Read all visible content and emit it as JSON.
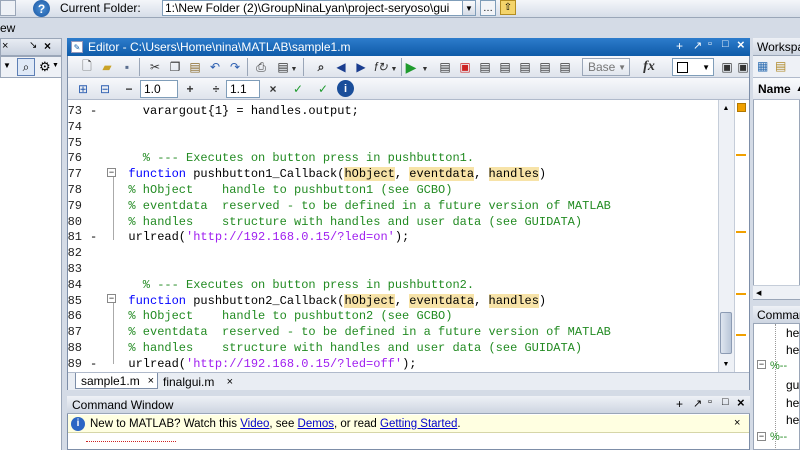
{
  "top": {
    "folder_label": "Current Folder:",
    "folder_path": "1:\\New Folder (2)\\GroupNinaLyan\\project-seryoso\\gui"
  },
  "left": {
    "view_label": "ew"
  },
  "editor": {
    "title": "Editor - C:\\Users\\Home\\nina\\MATLAB\\sample1.m",
    "base_label": "Base",
    "cell_value_1": "1.0",
    "cell_value_2": "1.1",
    "lines": [
      {
        "num": "73",
        "dash": "-",
        "segs": [
          {
            "t": "    varargout{1} = handles.output;",
            "c": ""
          }
        ]
      },
      {
        "num": "74",
        "dash": "",
        "segs": []
      },
      {
        "num": "75",
        "dash": "",
        "segs": []
      },
      {
        "num": "76",
        "dash": "",
        "segs": [
          {
            "t": "    % --- Executes on button press in pushbutton1.",
            "c": "cm"
          }
        ]
      },
      {
        "num": "77",
        "dash": "",
        "segs": [
          {
            "t": "  function ",
            "c": "kw"
          },
          {
            "t": "pushbutton1_Callback(",
            "c": ""
          },
          {
            "t": "hObject",
            "c": "hl"
          },
          {
            "t": ", ",
            "c": ""
          },
          {
            "t": "eventdata",
            "c": "hl"
          },
          {
            "t": ", ",
            "c": ""
          },
          {
            "t": "handles",
            "c": "hl"
          },
          {
            "t": ")",
            "c": ""
          }
        ]
      },
      {
        "num": "78",
        "dash": "",
        "segs": [
          {
            "t": "  % hObject    handle to pushbutton1 (see GCBO)",
            "c": "cm"
          }
        ]
      },
      {
        "num": "79",
        "dash": "",
        "segs": [
          {
            "t": "  % eventdata  reserved - to be defined in a future version of MATLAB",
            "c": "cm"
          }
        ]
      },
      {
        "num": "80",
        "dash": "",
        "segs": [
          {
            "t": "  % handles    structure with handles and user data (see GUIDATA)",
            "c": "cm"
          }
        ]
      },
      {
        "num": "81",
        "dash": "-",
        "segs": [
          {
            "t": "  urlread(",
            "c": ""
          },
          {
            "t": "'http://192.168.0.15/?led=on'",
            "c": "st"
          },
          {
            "t": ");",
            "c": ""
          }
        ]
      },
      {
        "num": "82",
        "dash": "",
        "segs": []
      },
      {
        "num": "83",
        "dash": "",
        "segs": []
      },
      {
        "num": "84",
        "dash": "",
        "segs": [
          {
            "t": "    % --- Executes on button press in pushbutton2.",
            "c": "cm"
          }
        ]
      },
      {
        "num": "85",
        "dash": "",
        "segs": [
          {
            "t": "  function ",
            "c": "kw"
          },
          {
            "t": "pushbutton2_Callback(",
            "c": ""
          },
          {
            "t": "hObject",
            "c": "hl"
          },
          {
            "t": ", ",
            "c": ""
          },
          {
            "t": "eventdata",
            "c": "hl"
          },
          {
            "t": ", ",
            "c": ""
          },
          {
            "t": "handles",
            "c": "hl"
          },
          {
            "t": ")",
            "c": ""
          }
        ]
      },
      {
        "num": "86",
        "dash": "",
        "segs": [
          {
            "t": "  % hObject    handle to pushbutton2 (see GCBO)",
            "c": "cm"
          }
        ]
      },
      {
        "num": "87",
        "dash": "",
        "segs": [
          {
            "t": "  % eventdata  reserved - to be defined in a future version of MATLAB",
            "c": "cm"
          }
        ]
      },
      {
        "num": "88",
        "dash": "",
        "segs": [
          {
            "t": "  % handles    structure with handles and user data (see GUIDATA)",
            "c": "cm"
          }
        ]
      },
      {
        "num": "89",
        "dash": "-",
        "segs": [
          {
            "t": "  urlread(",
            "c": ""
          },
          {
            "t": "'http://192.168.0.15/?led=off'",
            "c": "st"
          },
          {
            "t": ");",
            "c": ""
          }
        ]
      }
    ],
    "tabs": [
      {
        "label": "sample1.m"
      },
      {
        "label": "finalgui.m"
      }
    ]
  },
  "command": {
    "title": "Command Window",
    "info_prefix": "New to MATLAB? Watch this ",
    "link_video": "Video",
    "mid1": ", see ",
    "link_demos": "Demos",
    "mid2": ", or read ",
    "link_started": "Getting Started",
    "end": "."
  },
  "right": {
    "workspace_label": "Workspac",
    "name_header": "Name",
    "history_label": "Comman",
    "history_items": [
      "he",
      "he",
      "%-- ",
      "gu",
      "he",
      "he",
      "%-- "
    ]
  },
  "colors": {
    "accent": "#0f6fb8",
    "comment": "#228b22",
    "keyword": "#0000ff",
    "string": "#a020f0",
    "highlight": "#f7e3a8"
  }
}
